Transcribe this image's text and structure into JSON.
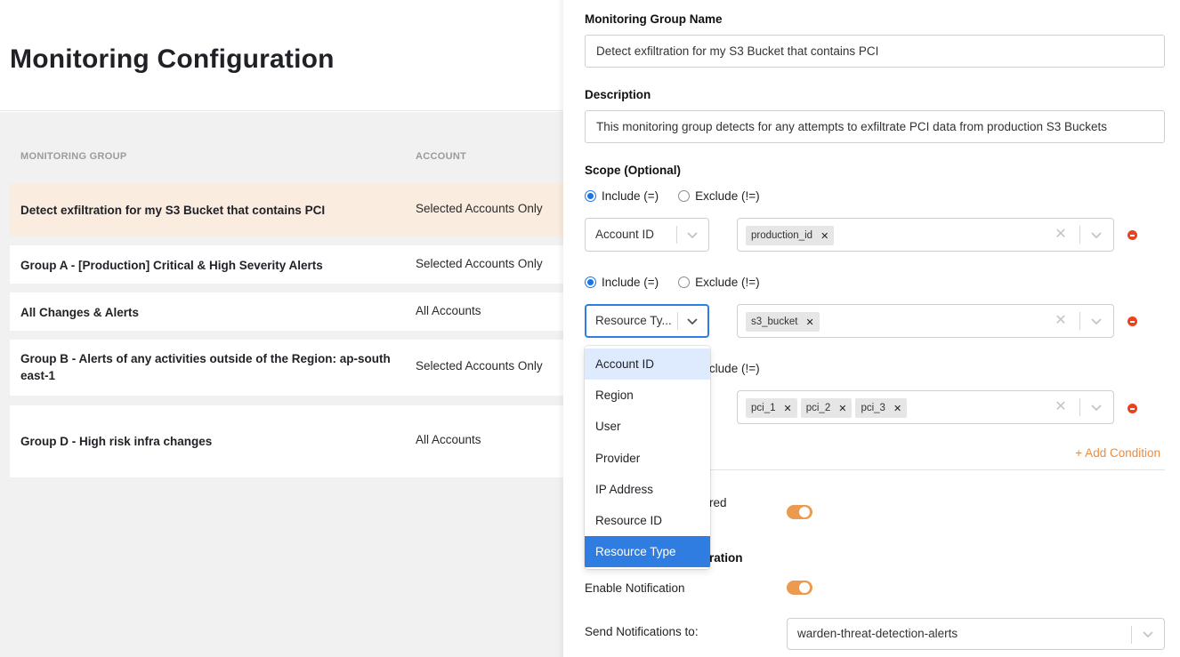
{
  "page": {
    "title": "Monitoring Configuration"
  },
  "table": {
    "columns": [
      "MONITORING GROUP",
      "ACCOUNT"
    ],
    "rows": [
      {
        "name": "Detect exfiltration for my S3 Bucket that contains PCI",
        "account": "Selected Accounts Only",
        "selected": true
      },
      {
        "name": "Group A - [Production] Critical & High Severity Alerts",
        "account": "Selected Accounts Only"
      },
      {
        "name": "All Changes & Alerts",
        "account": "All Accounts"
      },
      {
        "name": "Group B - Alerts of any activities outside of the Region: ap-southeast-1",
        "account": "Selected Accounts Only"
      },
      {
        "name": "Group D - High risk infra changes",
        "account": "All Accounts"
      }
    ]
  },
  "panel": {
    "name_label": "Monitoring Group Name",
    "name_value": "Detect exfiltration for my S3 Bucket that contains PCI",
    "description_label": "Description",
    "description_value": "This monitoring group detects for any attempts to exfiltrate PCI data from production S3 Buckets",
    "scope_label": "Scope (Optional)",
    "include_label": "Include (=)",
    "exclude_label": "Exclude (!=)",
    "conditions": [
      {
        "mode": "include",
        "field": "Account ID",
        "values": [
          "production_id"
        ]
      },
      {
        "mode": "include",
        "field": "Resource Ty...",
        "values": [
          "s3_bucket"
        ],
        "focused": true
      },
      {
        "mode": "include",
        "field": "",
        "values": [
          "pci_1",
          "pci_2",
          "pci_3"
        ]
      }
    ],
    "add_condition_label": "+ Add Condition",
    "partial_toggle_label": "red",
    "partial_section_label": "ration",
    "enable_notification_label": "Enable Notification",
    "send_to_label": "Send Notifications to:",
    "send_to_value": "warden-threat-detection-alerts",
    "toggles": {
      "first": true,
      "enable_notification": true
    }
  },
  "dropdown": {
    "options": [
      "Account ID",
      "Region",
      "User",
      "Provider",
      "IP Address",
      "Resource ID",
      "Resource Type"
    ],
    "hovered": "Account ID",
    "selected": "Resource Type"
  },
  "colors": {
    "accent_orange": "#ec9a4f",
    "selected_row": "#fbece0",
    "focus_blue": "#2f7de1",
    "remove_red": "#e8421f"
  }
}
